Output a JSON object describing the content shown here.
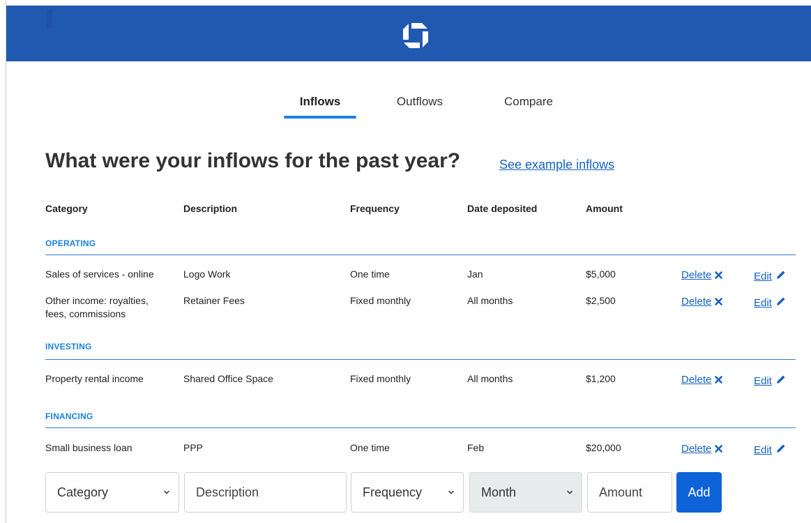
{
  "colors": {
    "header_bg": "#2159b0",
    "accent": "#1a82e2",
    "link": "#1462c4",
    "button": "#0e63d8"
  },
  "header": {
    "logo_icon": "chase-octagon-logo"
  },
  "tabs": [
    {
      "label": "Inflows",
      "active": true
    },
    {
      "label": "Outflows",
      "active": false
    },
    {
      "label": "Compare",
      "active": false
    }
  ],
  "heading": "What were your inflows for the past year?",
  "example_link": "See example inflows",
  "columns": [
    "Category",
    "Description",
    "Frequency",
    "Date deposited",
    "Amount"
  ],
  "sections": [
    {
      "label": "OPERATING",
      "rows": [
        {
          "category": [
            "Sales of services - online"
          ],
          "description": "Logo Work",
          "frequency": "One time",
          "date": "Jan",
          "amount": "$5,000"
        },
        {
          "category": [
            "Other income: royalties,",
            "fees, commissions"
          ],
          "description": "Retainer Fees",
          "frequency": "Fixed monthly",
          "date": "All months",
          "amount": "$2,500"
        }
      ]
    },
    {
      "label": "INVESTING",
      "rows": [
        {
          "category": [
            "Property rental income"
          ],
          "description": "Shared Office Space",
          "frequency": "Fixed monthly",
          "date": "All months",
          "amount": "$1,200"
        }
      ]
    },
    {
      "label": "FINANCING",
      "rows": [
        {
          "category": [
            "Small business loan"
          ],
          "description": "PPP",
          "frequency": "One time",
          "date": "Feb",
          "amount": "$20,000"
        }
      ]
    }
  ],
  "row_actions": {
    "delete_label": "Delete",
    "delete_icon": "close-x-icon",
    "edit_label": "Edit",
    "edit_icon": "pencil-icon"
  },
  "add_form": {
    "category_placeholder": "Category",
    "description_placeholder": "Description",
    "frequency_placeholder": "Frequency",
    "month_placeholder": "Month",
    "amount_placeholder": "Amount",
    "add_label": "Add"
  }
}
